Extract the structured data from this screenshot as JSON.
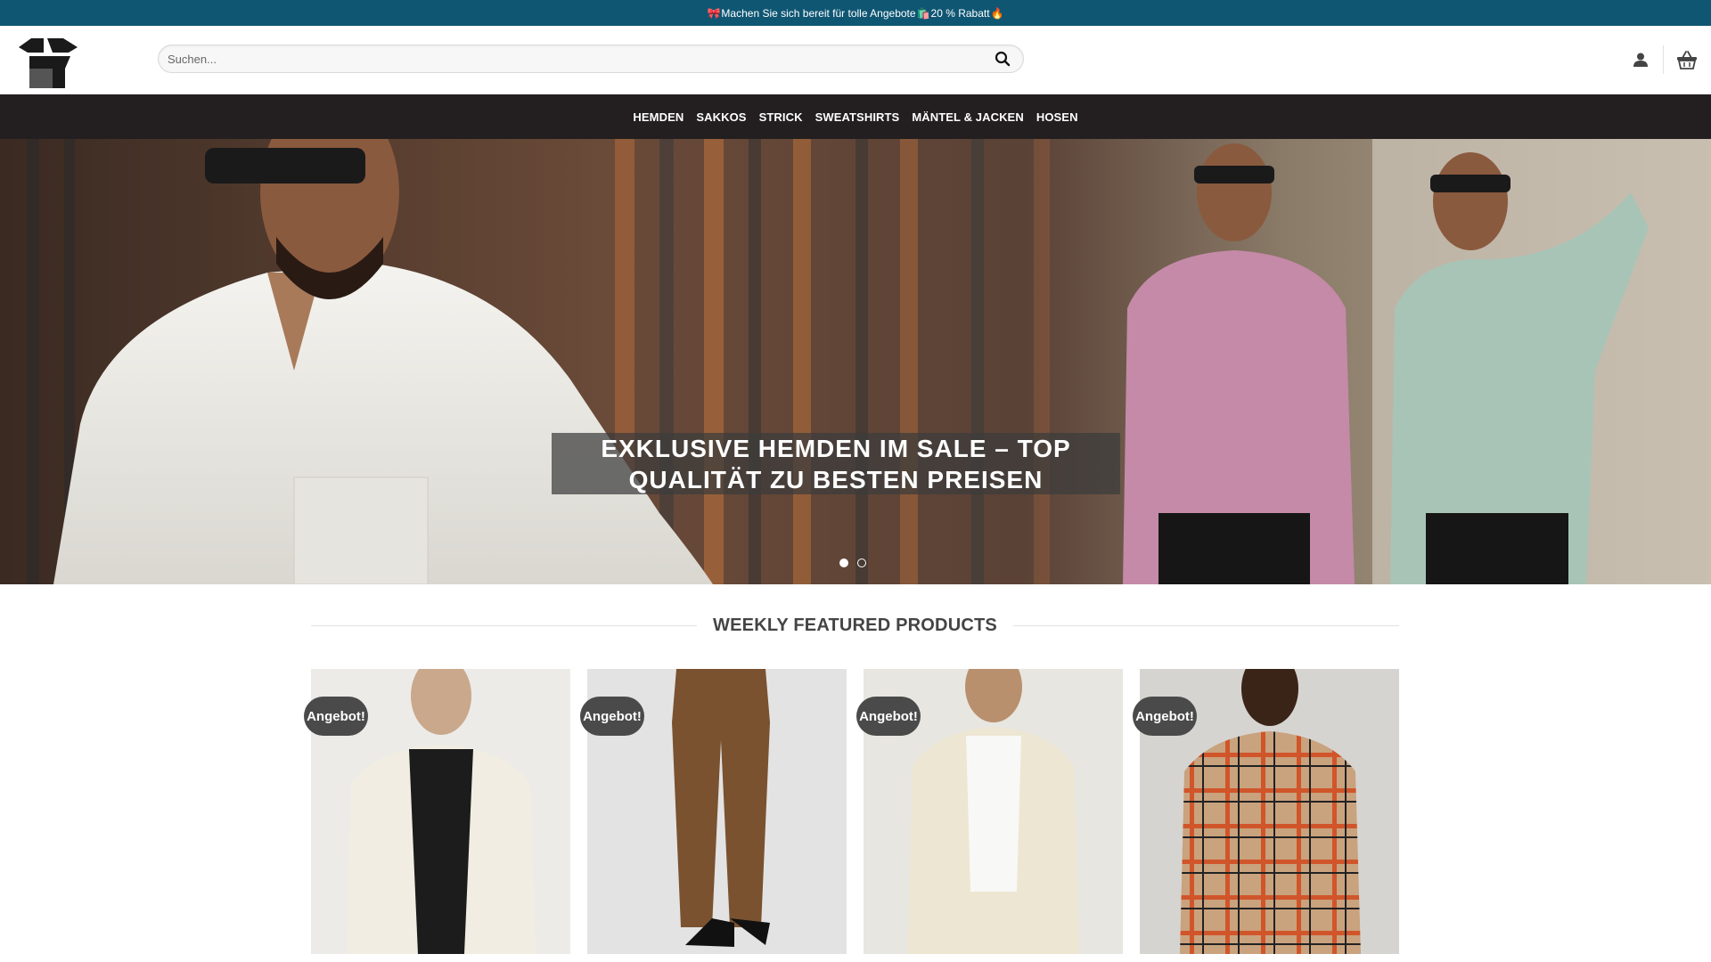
{
  "announcement": {
    "text_a": "Machen Sie sich bereit für tolle Angebote",
    "text_b": "20 % Rabatt",
    "emoji_1": "🎀",
    "emoji_2": "🛍️",
    "emoji_3": "🔥"
  },
  "header": {
    "search_placeholder": "Suchen...",
    "icons": [
      "logo-icon",
      "search-icon",
      "user-icon",
      "basket-icon"
    ]
  },
  "nav": {
    "items": [
      "HEMDEN",
      "SAKKOS",
      "STRICK",
      "SWEATSHIRTS",
      "MÄNTEL & JACKEN",
      "HOSEN"
    ]
  },
  "hero": {
    "caption_line1": "EXKLUSIVE HEMDEN IM SALE – TOP",
    "caption_line2": "QUALITÄT ZU BESTEN PREISEN",
    "slides": 2,
    "active_slide": 1
  },
  "featured": {
    "title": "WEEKLY FEATURED PRODUCTS",
    "products": [
      {
        "badge": "Angebot!"
      },
      {
        "badge": "Angebot!"
      },
      {
        "badge": "Angebot!"
      },
      {
        "badge": "Angebot!"
      }
    ]
  },
  "colors": {
    "announcement_bg": "#0f5673",
    "nav_bg": "#231f20",
    "badge_bg": "#4a4a4a"
  }
}
